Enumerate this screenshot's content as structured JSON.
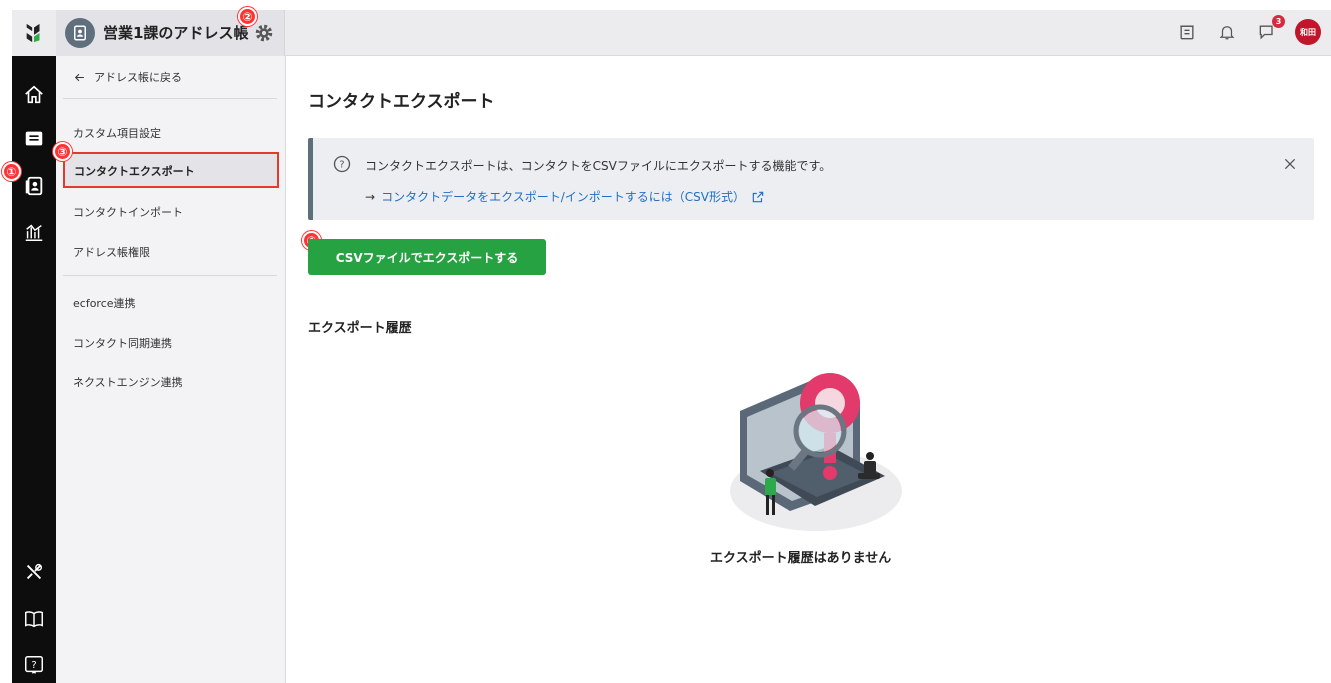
{
  "header": {
    "title": "営業1課のアドレス帳",
    "notification_count": "3",
    "user_initials": "和田"
  },
  "sidebar": {
    "back_label": "アドレス帳に戻る",
    "items": [
      {
        "label": "カスタム項目設定"
      },
      {
        "label": "コンタクトエクスポート"
      },
      {
        "label": "コンタクトインポート"
      },
      {
        "label": "アドレス帳権限"
      },
      {
        "label": "ecforce連携"
      },
      {
        "label": "コンタクト同期連携"
      },
      {
        "label": "ネクストエンジン連携"
      }
    ]
  },
  "main": {
    "title": "コンタクトエクスポート",
    "info_text": "コンタクトエクスポートは、コンタクトをCSVファイルにエクスポートする機能です。",
    "info_link": "コンタクトデータをエクスポート/インポートするには（CSV形式）",
    "export_button": "CSVファイルでエクスポートする",
    "history_title": "エクスポート履歴",
    "empty_message": "エクスポート履歴はありません"
  },
  "markers": [
    "①",
    "②",
    "③",
    "④"
  ],
  "colors": {
    "accent_green": "#27a243",
    "link_blue": "#1f6fc4",
    "highlight_red": "#e5382e",
    "rail_black": "#0d0d0d"
  }
}
